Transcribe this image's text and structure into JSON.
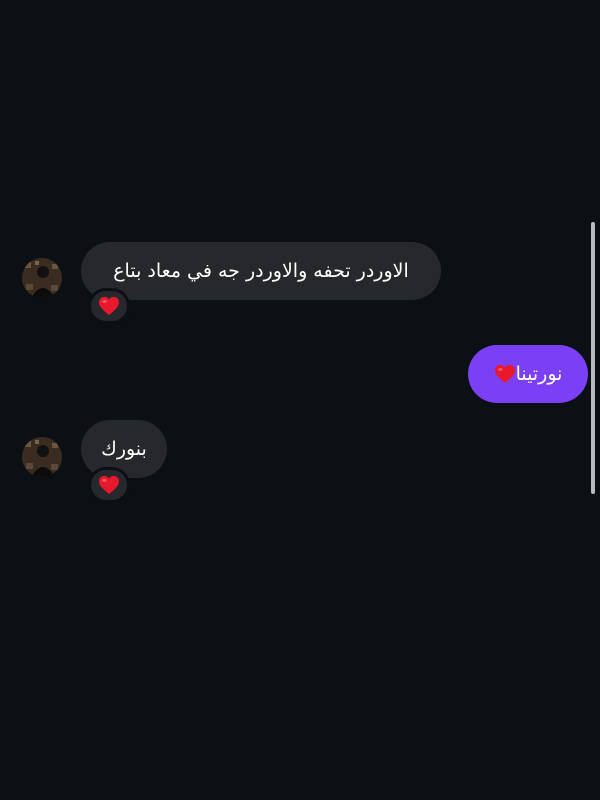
{
  "messages": [
    {
      "direction": "received",
      "text": "الاوردر تحفه والاوردر جه في معاد بتاع",
      "reaction": "red-heart-icon"
    },
    {
      "direction": "sent",
      "text": "نورتينا",
      "emoji": "red-heart-icon"
    },
    {
      "direction": "received",
      "text": "بنورك",
      "reaction": "red-heart-icon"
    }
  ],
  "colors": {
    "background": "#0b1014",
    "received_bubble": "#26282c",
    "sent_bubble": "#7b40f5",
    "heart": "#e8192c"
  }
}
